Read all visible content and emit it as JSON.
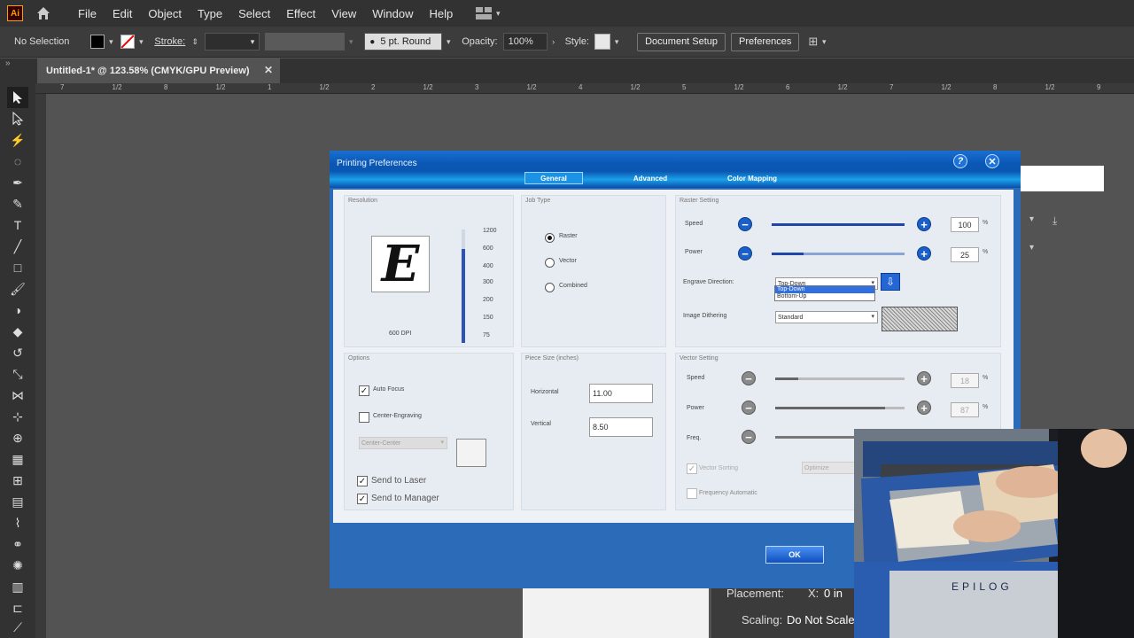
{
  "app": {
    "logo_text": "Ai"
  },
  "menu": [
    "File",
    "Edit",
    "Object",
    "Type",
    "Select",
    "Effect",
    "View",
    "Window",
    "Help"
  ],
  "control_bar": {
    "selection": "No Selection",
    "stroke_label": "Stroke:",
    "brush": "5 pt. Round",
    "opacity_label": "Opacity:",
    "opacity_value": "100%",
    "style_label": "Style:",
    "document_setup": "Document Setup",
    "preferences": "Preferences"
  },
  "document_tab": {
    "title": "Untitled-1* @ 123.58% (CMYK/GPU Preview)",
    "close": "✕"
  },
  "ruler": [
    "7",
    "1/2",
    "8",
    "1/2",
    "1",
    "1/2",
    "2",
    "1/2",
    "3",
    "1/2",
    "4",
    "1/2",
    "5",
    "1/2",
    "6",
    "1/2",
    "7",
    "1/2",
    "8",
    "1/2",
    "9",
    "1/2"
  ],
  "print_panel": {
    "placement_label": "Placement:",
    "x_label": "X:",
    "x_value": "0 in",
    "scaling_label": "Scaling:",
    "scaling_value": "Do Not Scale"
  },
  "dialog": {
    "title": "Printing Preferences",
    "help": "?",
    "close": "✕",
    "tabs": {
      "general": "General",
      "advanced": "Advanced",
      "color_mapping": "Color Mapping"
    },
    "resolution": {
      "title": "Resolution",
      "preview_letter": "E",
      "dpi_label": "600 DPI",
      "dpi_values": [
        "1200",
        "600",
        "400",
        "300",
        "200",
        "150",
        "75"
      ],
      "selected_dpi_fraction": 0.83
    },
    "job_type": {
      "title": "Job Type",
      "options": [
        "Raster",
        "Vector",
        "Combined"
      ],
      "selected": "Raster"
    },
    "raster": {
      "title": "Raster Setting",
      "speed_label": "Speed",
      "speed_value": "100",
      "power_label": "Power",
      "power_value": "25",
      "unit": "%",
      "engrave_direction_label": "Engrave Direction:",
      "engrave_direction_value": "Top-Down",
      "engrave_direction_options": [
        "Top-Down",
        "Bottom-Up"
      ],
      "image_dithering_label": "Image Dithering",
      "image_dithering_value": "Standard"
    },
    "options": {
      "title": "Options",
      "auto_focus": "Auto Focus",
      "center_engraving": "Center-Engraving",
      "center_select": "Center-Center",
      "send_to_laser": "Send to Laser",
      "send_to_manager": "Send to Manager"
    },
    "piece_size": {
      "title": "Piece Size (inches)",
      "horizontal_label": "Horizontal",
      "horizontal_value": "11.00",
      "vertical_label": "Vertical",
      "vertical_value": "8.50"
    },
    "vector": {
      "title": "Vector Setting",
      "speed_label": "Speed",
      "speed_value": "18",
      "power_label": "Power",
      "power_value": "87",
      "freq_label": "Freq.",
      "unit": "%",
      "vector_sorting": "Vector Sorting",
      "sorting_value": "Optimize",
      "frequency_automatic": "Frequency Automatic"
    },
    "ok": "OK"
  },
  "webcam": {
    "brand": "EPILOG"
  }
}
